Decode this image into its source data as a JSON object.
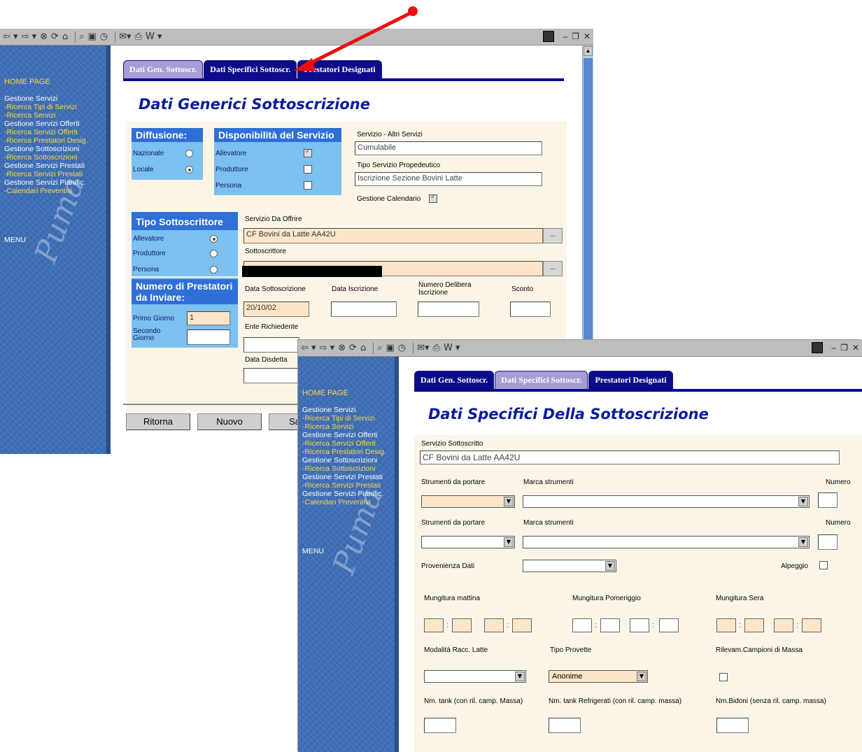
{
  "colors": {
    "accent": "#0c0c8a",
    "sidebar": "#3f6fb6",
    "arrow": "#e81010",
    "field_peach": "#fde6c7",
    "section_blue": "#7cc0f0"
  },
  "toolbar_icons": [
    "back-icon",
    "forward-icon",
    "stop-icon",
    "refresh-icon",
    "home-icon",
    "search-icon",
    "favorites-icon",
    "history-icon",
    "mail-icon",
    "print-icon",
    "edit-icon"
  ],
  "toolbar": {
    "back": "⇦ ▾",
    "forward": "⇨ ▾",
    "stop": "⊗",
    "refresh": "⟳",
    "home": "⌂",
    "search": "⌕",
    "fav": "▣",
    "hist": "◷",
    "mail": "✉▾",
    "print": "⎙",
    "edit": "W ▾",
    "minimize": "–",
    "maximize": "❐",
    "close": "✕"
  },
  "sidebar": {
    "home": "HOME PAGE",
    "items": [
      {
        "label": "Gestione Servizi",
        "style": "w"
      },
      {
        "label": "-Ricerca Tipi di Servizi",
        "style": "y"
      },
      {
        "label": "-Ricerca Servizi",
        "style": "y"
      },
      {
        "label": "Gestione Servizi Offerti",
        "style": "w"
      },
      {
        "label": "-Ricerca Servizi Offerti",
        "style": "y"
      },
      {
        "label": "-Ricerca Prestatori Desig.",
        "style": "y"
      },
      {
        "label": "Gestione Sottoscrizioni",
        "style": "w"
      },
      {
        "label": "-Ricerca Sottoscrizioni",
        "style": "y"
      },
      {
        "label": "Gestione Servizi Prestati",
        "style": "w"
      },
      {
        "label": "-Ricerca Servizi Prestati",
        "style": "y"
      },
      {
        "label": "Gestione Servizi Pianific.",
        "style": "w"
      },
      {
        "label": "-Calendari Preventivi",
        "style": "y"
      }
    ],
    "menu": "MENU",
    "signature": "Puma"
  },
  "tabs": {
    "t1": "Dati Gen. Sottoscr.",
    "t2": "Dati Specifici Sottoscr.",
    "t3": "Prestatori Designati"
  },
  "w1": {
    "title": "Dati Generici Sottoscrizione",
    "diffusione": {
      "head": "Diffusione:",
      "nazionale": "Nazionale",
      "locale": "Locale"
    },
    "disponibilita": {
      "head": "Disponibilità del Servizio",
      "allevatore": "Allevatore",
      "produttore": "Produttore",
      "persona": "Persona"
    },
    "altri": {
      "label": "Servizio - Altri Servizi",
      "value": "Cumulabile"
    },
    "propedeutico": {
      "label": "Tipo Servizio Propedeutico",
      "value": "Iscrizione Sezione Bovini Latte"
    },
    "calendario": "Gestione Calendario",
    "tipo": {
      "head": "Tipo Sottoscrittore",
      "allevatore": "Allevatore",
      "produttore": "Produttore",
      "persona": "Persona"
    },
    "numero": {
      "head": "Numero di Prestatori da Inviare:",
      "primo": "Primo Giorno",
      "primo_val": "1",
      "secondo": "Secondo Giorno"
    },
    "servizio_offrire": {
      "label": "Servizio Da Offrire",
      "value": "CF Bovini da Latte AA42U"
    },
    "sottoscrittore": {
      "label": "Sottoscrittore"
    },
    "data_sott": {
      "label": "Data Sottoscrizione",
      "value": "20/10/02"
    },
    "data_iscr": "Data Iscrizione",
    "num_delibera": "Numero Delibera Iscrizione",
    "sconto": "Sconto",
    "ente": "Ente Richiedente",
    "disdetta": "Data Disdetta",
    "dots": "...",
    "buttons": {
      "ritorna": "Ritorna",
      "nuovo": "Nuovo",
      "sa": "Sa"
    }
  },
  "w2": {
    "title": "Dati Specifici Della Sottoscrizione",
    "servizio": {
      "label": "Servizio Sottoscritto",
      "value": "CF Bovini da Latte AA42U"
    },
    "strumenti": "Strumenti da portare",
    "marca": "Marca strumenti",
    "numero": "Numero",
    "provenienza": "Provenienza Dati",
    "alpeggio": "Alpeggio",
    "mattina": "Mungitura mattina",
    "pomeriggio": "Mungitura Pomeriggio",
    "sera": "Mungitura Sera",
    "modalita": "Modalità Racc. Latte",
    "provette": {
      "label": "Tipo Provette",
      "value": "Anonime"
    },
    "rilevam": "Rilevam.Campioni di Massa",
    "tank": "Nm. tank (con ril. camp. Massa)",
    "tank_refr": "Nm. tank Refrigerati (con ril. camp. massa)",
    "bidoni": "Nm.Bidoni (senza ril. camp. massa)",
    "colon": ":",
    "dd": "▼"
  }
}
